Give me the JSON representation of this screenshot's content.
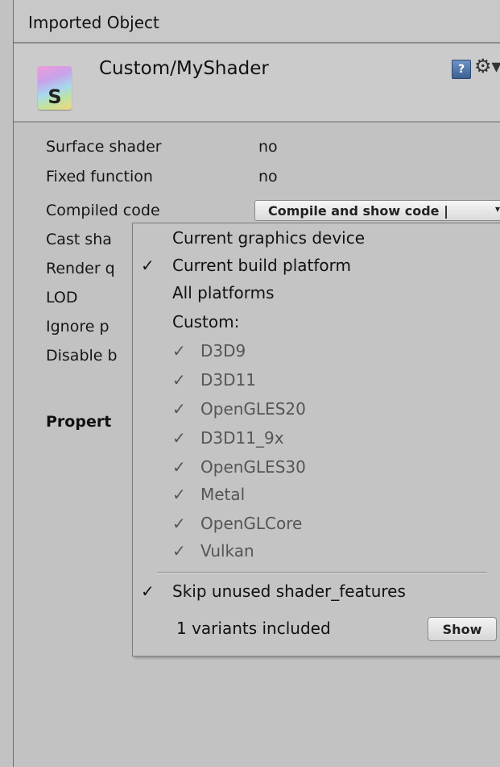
{
  "window": {
    "title": "Imported Object"
  },
  "header": {
    "icon_letter": "S",
    "shader_name": "Custom/MyShader",
    "help_icon_glyph": "?",
    "settings_icon_glyph": "⚙▾"
  },
  "properties": [
    {
      "label": "Surface shader",
      "value": "no"
    },
    {
      "label": "Fixed function",
      "value": "no"
    },
    {
      "label": "Compiled code"
    },
    {
      "label": "Cast sha"
    },
    {
      "label": "Render q"
    },
    {
      "label": "LOD"
    },
    {
      "label": "Ignore p"
    },
    {
      "label": "Disable b"
    }
  ],
  "properties_heading": "Propert",
  "compiled_code_dropdown": {
    "label": "Compile and show code |",
    "arrow": "▾"
  },
  "menu": {
    "items": [
      {
        "label": "Current graphics device",
        "check": ""
      },
      {
        "label": "Current build platform",
        "check": "✓"
      },
      {
        "label": "All platforms",
        "check": ""
      },
      {
        "label": "Custom:",
        "check": ""
      }
    ],
    "platforms": [
      {
        "label": "D3D9",
        "check": "✓"
      },
      {
        "label": "D3D11",
        "check": "✓"
      },
      {
        "label": "OpenGLES20",
        "check": "✓"
      },
      {
        "label": "D3D11_9x",
        "check": "✓"
      },
      {
        "label": "OpenGLES30",
        "check": "✓"
      },
      {
        "label": "Metal",
        "check": "✓"
      },
      {
        "label": "OpenGLCore",
        "check": "✓"
      },
      {
        "label": "Vulkan",
        "check": "✓"
      }
    ],
    "skip_unused": {
      "label": "Skip unused shader_features",
      "check": "✓"
    },
    "variants_text": "1 variants included",
    "show_button": "Show"
  }
}
